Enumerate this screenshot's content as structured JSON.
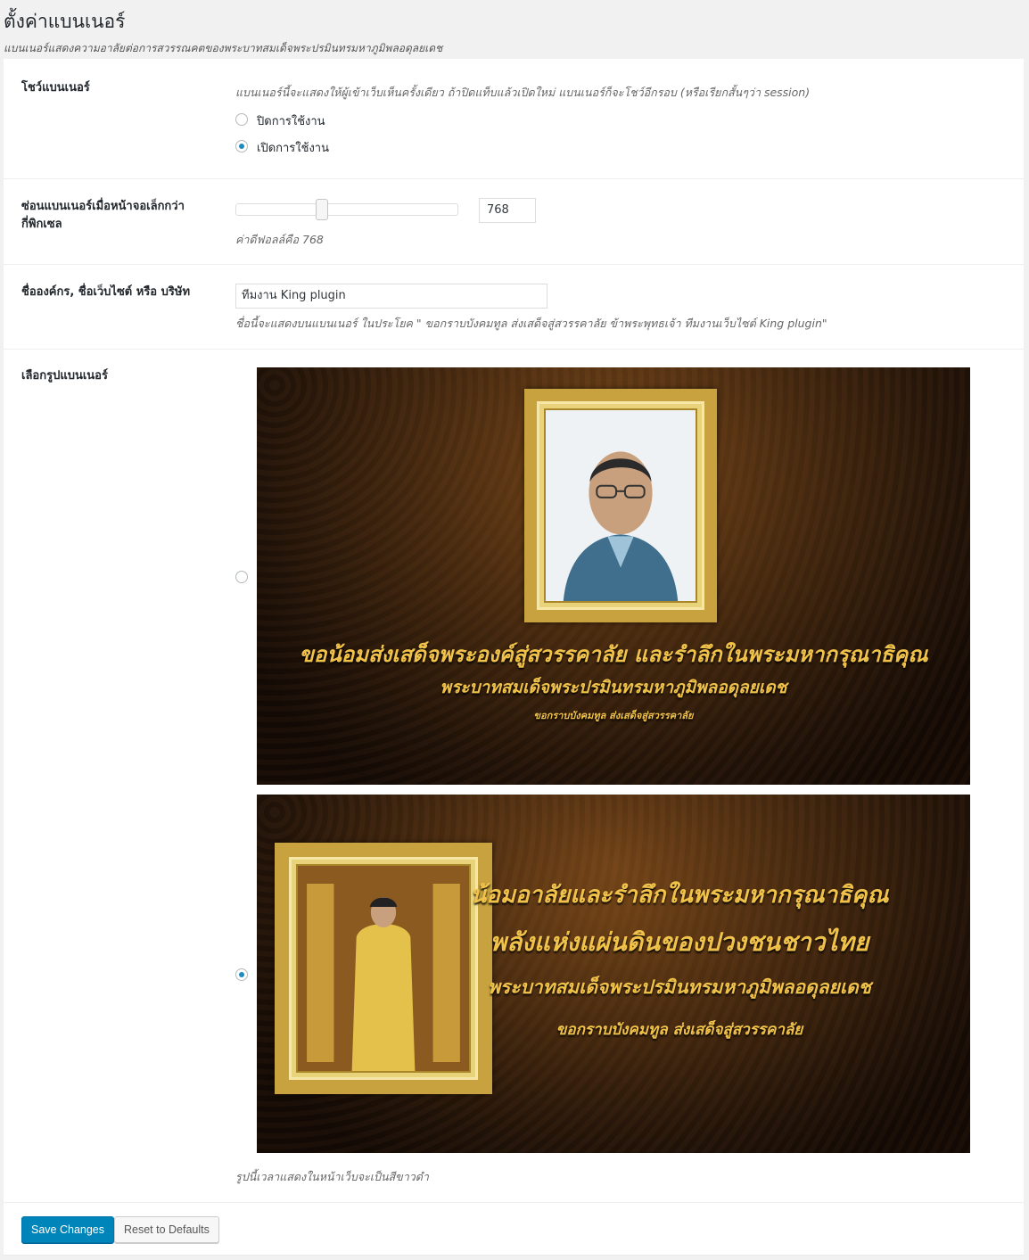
{
  "page": {
    "title": "ตั้งค่าแบนเนอร์",
    "description": "แบนเนอร์แสดงความอาลัยต่อการสวรรณคตของพระบาทสมเด็จพระปรมินทรมหาภูมิพลอดุลยเดช"
  },
  "show_banner": {
    "label": "โชว์แบนเนอร์",
    "description": "แบนเนอร์นี้จะแสดงให้ผู้เข้าเว็บเห็นครั้งเดียว ถ้าปิดแท็บแล้วเปิดใหม่ แบนเนอร์ก็จะโชว์อีกรอบ (หรือเรียกสั้นๆว่า session)",
    "options": [
      {
        "label": "ปิดการใช้งาน",
        "checked": false
      },
      {
        "label": "เปิดการใช้งาน",
        "checked": true
      }
    ]
  },
  "hide_small": {
    "label": "ซ่อนแบนเนอร์เมื่อหน้าจอเล็กกว่ากี่พิกเซล",
    "value": "768",
    "slider_fraction": 0.37,
    "description": "ค่าดีฟอลล์คือ 768"
  },
  "org_name": {
    "label": "ชื่อองค์กร, ชื่อเว็บไซต์ หรือ บริษัท",
    "value": "ทีมงาน King plugin",
    "description": "ชื่อนี้จะแสดงบนแบนเนอร์ ในประโยค \" ขอกราบบังคมทูล ส่งเสด็จสู่สวรรคาลัย ข้าพระพุทธเจ้า ทีมงานเว็บไซต์ King plugin\""
  },
  "banner_choice": {
    "label": "เลือกรูปแบนเนอร์",
    "banners": [
      {
        "checked": false,
        "line1": "ขอน้อมส่งเสด็จพระองค์สู่สวรรคาลัย และรำลึกในพระมหากรุณาธิคุณ",
        "line2": "พระบาทสมเด็จพระปรมินทรมหาภูมิพลอดุลยเดช",
        "line3": "ขอกราบบังคมทูล ส่งเสด็จสู่สวรรคาลัย"
      },
      {
        "checked": true,
        "line1": "น้อมอาลัยและรำลึกในพระมหากรุณาธิคุณ",
        "line2": "พลังแห่งแผ่นดินของปวงชนชาวไทย",
        "line3": "พระบาทสมเด็จพระปรมินทรมหาภูมิพลอดุลยเดช",
        "line4": "ขอกราบบังคมทูล ส่งเสด็จสู่สวรรคาลัย"
      }
    ],
    "note": "รูปนี้เวลาแสดงในหน้าเว็บจะเป็นสีขาวดำ"
  },
  "buttons": {
    "save": "Save Changes",
    "reset": "Reset to Defaults"
  }
}
